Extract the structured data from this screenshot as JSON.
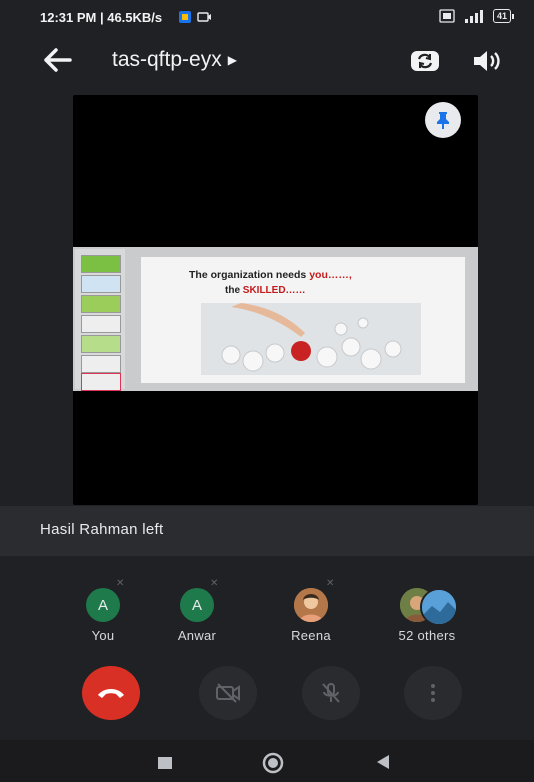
{
  "status_bar": {
    "text": "12:31 PM | 46.5KB/s",
    "battery": "41"
  },
  "app_bar": {
    "meeting_code": "tas-qftp-eyx"
  },
  "slide": {
    "line1_prefix": "The organization needs ",
    "line1_highlight": "you……,",
    "line2_prefix": "the ",
    "line2_highlight": "SKILLED……"
  },
  "notice": {
    "text": "Hasil Rahman left"
  },
  "participants": [
    {
      "name": "You",
      "initial": "A"
    },
    {
      "name": "Anwar",
      "initial": "A"
    },
    {
      "name": "Reena",
      "initial": ""
    },
    {
      "name": "52 others",
      "initial": ""
    }
  ],
  "colors": {
    "background": "#202124",
    "end_call": "#d93025",
    "avatar_green": "#1e7a4b"
  }
}
